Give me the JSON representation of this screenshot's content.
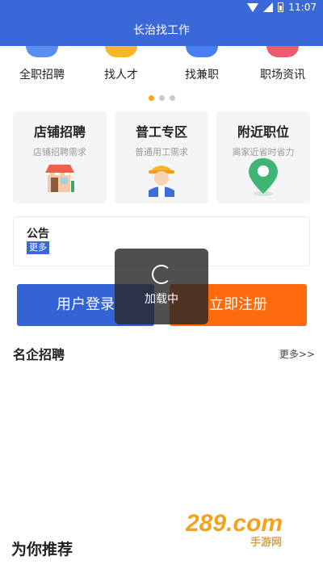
{
  "status_bar": {
    "time": "11:07"
  },
  "header": {
    "title": "长治找工作"
  },
  "nav": [
    {
      "label": "全职招聘",
      "icon": "fulltime-icon",
      "color": "#5b8def"
    },
    {
      "label": "找人才",
      "icon": "talent-icon",
      "color": "#f5b928"
    },
    {
      "label": "找兼职",
      "icon": "parttime-icon",
      "color": "#4a7ef0"
    },
    {
      "label": "职场资讯",
      "icon": "news-icon",
      "color": "#f05a6e"
    }
  ],
  "carousel": {
    "active_index": 0,
    "count": 3
  },
  "cards": [
    {
      "title": "店铺招聘",
      "subtitle": "店铺招聘需求",
      "icon": "shop-icon"
    },
    {
      "title": "普工专区",
      "subtitle": "普通用工需求",
      "icon": "worker-icon"
    },
    {
      "title": "附近职位",
      "subtitle": "离家近省时省力",
      "icon": "location-pin-icon"
    }
  ],
  "notice": {
    "title": "公告",
    "more": "更多"
  },
  "buttons": {
    "login": "用户登录",
    "register": "立即注册"
  },
  "loading": {
    "text": "加载中"
  },
  "famous": {
    "title": "名企招聘",
    "more": "更多>>"
  },
  "watermark": {
    "text": "289.com",
    "sub": "手游网"
  },
  "recommend": {
    "title": "为你推荐"
  },
  "colors": {
    "primary": "#3a68d8",
    "accent": "#ff6a0f",
    "dot_active": "#f2a91c"
  }
}
